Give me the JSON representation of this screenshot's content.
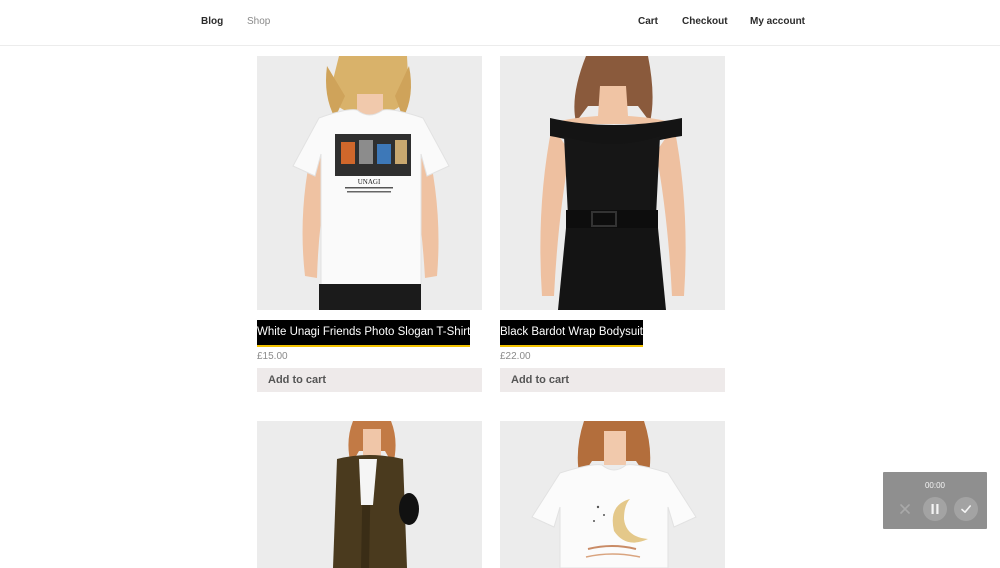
{
  "nav": {
    "blog": "Blog",
    "shop": "Shop",
    "cart": "Cart",
    "checkout": "Checkout",
    "account": "My account"
  },
  "products": [
    {
      "title": "White Unagi Friends Photo Slogan T-Shirt",
      "price": "£15.00",
      "button": "Add to cart"
    },
    {
      "title": "Black Bardot Wrap Bodysuit",
      "price": "£22.00",
      "button": "Add to cart"
    },
    {
      "title": "",
      "price": "",
      "button": ""
    },
    {
      "title": "",
      "price": "",
      "button": ""
    }
  ],
  "print": {
    "slogan": "UNAGI"
  },
  "recorder": {
    "time": "00:00",
    "icons": [
      "close-icon",
      "pause-icon",
      "check-icon"
    ]
  },
  "colors": {
    "title_bg": "#000000",
    "title_underline": "#f2c200",
    "button_bg": "#eeeaea",
    "recorder_bg": "#8f8f8f"
  }
}
